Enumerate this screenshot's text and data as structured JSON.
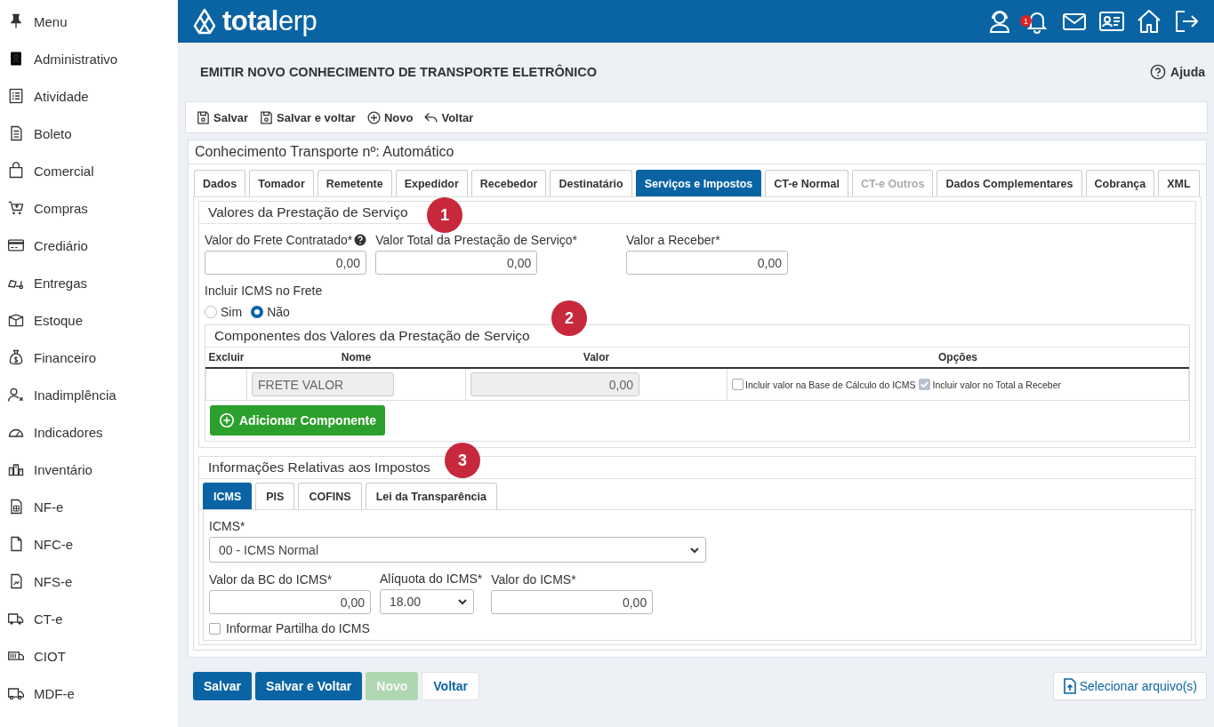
{
  "sidebar": {
    "items": [
      {
        "label": "Menu"
      },
      {
        "label": "Administrativo"
      },
      {
        "label": "Atividade"
      },
      {
        "label": "Boleto"
      },
      {
        "label": "Comercial"
      },
      {
        "label": "Compras"
      },
      {
        "label": "Crediário"
      },
      {
        "label": "Entregas"
      },
      {
        "label": "Estoque"
      },
      {
        "label": "Financeiro"
      },
      {
        "label": "Inadimplência"
      },
      {
        "label": "Indicadores"
      },
      {
        "label": "Inventário"
      },
      {
        "label": "NF-e"
      },
      {
        "label": "NFC-e"
      },
      {
        "label": "NFS-e"
      },
      {
        "label": "CT-e"
      },
      {
        "label": "CIOT"
      },
      {
        "label": "MDF-e"
      }
    ]
  },
  "header": {
    "logo_bold": "total",
    "logo_light": "erp",
    "notification_count": "1"
  },
  "page": {
    "title": "EMITIR NOVO CONHECIMENTO DE TRANSPORTE ELETRÔNICO",
    "help": "Ajuda"
  },
  "toolbar": [
    {
      "label": "Salvar",
      "kind": "save"
    },
    {
      "label": "Salvar e voltar",
      "kind": "save"
    },
    {
      "label": "Novo",
      "kind": "new"
    },
    {
      "label": "Voltar",
      "kind": "back"
    }
  ],
  "form": {
    "title": "Conhecimento Transporte nº: Automático",
    "tabs": [
      {
        "label": "Dados",
        "selected": false,
        "disabled": false
      },
      {
        "label": "Tomador",
        "selected": false,
        "disabled": false
      },
      {
        "label": "Remetente",
        "selected": false,
        "disabled": false
      },
      {
        "label": "Expedidor",
        "selected": false,
        "disabled": false
      },
      {
        "label": "Recebedor",
        "selected": false,
        "disabled": false
      },
      {
        "label": "Destinatário",
        "selected": false,
        "disabled": false
      },
      {
        "label": "Serviços e Impostos",
        "selected": true,
        "disabled": false
      },
      {
        "label": "CT-e Normal",
        "selected": false,
        "disabled": false
      },
      {
        "label": "CT-e Outros",
        "selected": false,
        "disabled": true
      },
      {
        "label": "Dados Complementares",
        "selected": false,
        "disabled": false
      },
      {
        "label": "Cobrança",
        "selected": false,
        "disabled": false
      },
      {
        "label": "XML",
        "selected": false,
        "disabled": false
      }
    ],
    "values_section": {
      "title": "Valores da Prestação de Serviço",
      "fields": [
        {
          "label": "Valor do Frete Contratado*",
          "value": "0,00",
          "help": true
        },
        {
          "label": "Valor Total da Prestação de Serviço*",
          "value": "0,00",
          "help": false
        },
        {
          "label": "Valor a Receber*",
          "value": "0,00",
          "help": false
        }
      ],
      "icms_in_freight": {
        "label": "Incluir ICMS no Frete",
        "options": [
          {
            "label": "Sim",
            "selected": false
          },
          {
            "label": "Não",
            "selected": true
          }
        ]
      }
    },
    "components_section": {
      "title": "Componentes dos Valores da Prestação de Serviço",
      "columns": [
        "Excluir",
        "Nome",
        "Valor",
        "Opções"
      ],
      "rows": [
        {
          "name": "FRETE VALOR",
          "value": "0,00",
          "options": [
            {
              "label": "Incluir valor na Base de Cálculo do ICMS",
              "checked": false,
              "disabled": false
            },
            {
              "label": "Incluir valor no Total a Receber",
              "checked": true,
              "disabled": true
            }
          ]
        }
      ],
      "add_button": "Adicionar Componente"
    },
    "taxes_section": {
      "title": "Informações Relativas aos Impostos",
      "tabs": [
        {
          "label": "ICMS",
          "selected": true
        },
        {
          "label": "PIS",
          "selected": false
        },
        {
          "label": "COFINS",
          "selected": false
        },
        {
          "label": "Lei da Transparência",
          "selected": false
        }
      ],
      "icms": {
        "label": "ICMS*",
        "value": "00 - ICMS Normal"
      },
      "bc": {
        "label": "Valor da BC do ICMS*",
        "value": "0,00"
      },
      "rate": {
        "label": "Alíquota do ICMS*",
        "value": "18.00"
      },
      "icms_value": {
        "label": "Valor do ICMS*",
        "value": "0,00"
      },
      "partilha": {
        "label": "Informar Partilha do ICMS",
        "checked": false
      }
    }
  },
  "markers": [
    "1",
    "2",
    "3"
  ],
  "buttons": [
    {
      "label": "Salvar",
      "kind": "primary",
      "disabled": false
    },
    {
      "label": "Salvar e Voltar",
      "kind": "primary",
      "disabled": false
    },
    {
      "label": "Novo",
      "kind": "success",
      "disabled": true
    },
    {
      "label": "Voltar",
      "kind": "link",
      "disabled": false
    }
  ],
  "file_button": "Selecionar arquivo(s)"
}
